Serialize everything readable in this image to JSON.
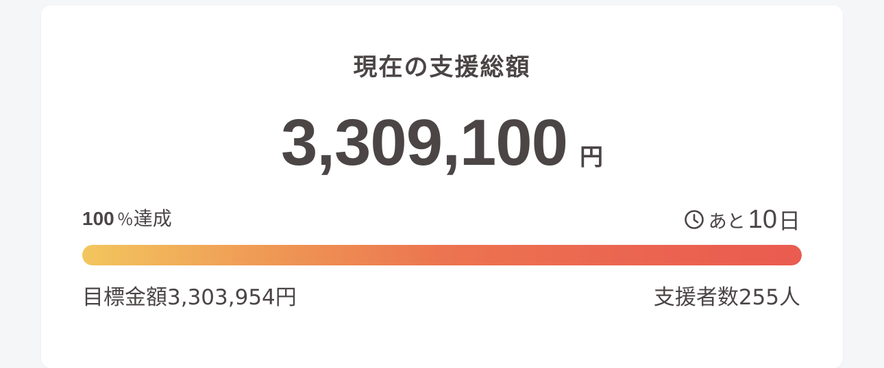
{
  "summary": {
    "title": "現在の支援総額",
    "amount": "3,309,100",
    "amount_unit": "円"
  },
  "progress": {
    "percent_value": "100",
    "percent_sign": "％",
    "achieved_label": "達成",
    "fill_fraction": 1.0,
    "gradient_colors": [
      "#f3c65e",
      "#ef9a55",
      "#ec7450",
      "#eb6650",
      "#ea5b50"
    ]
  },
  "remaining": {
    "icon": "clock-icon",
    "prefix": "あと",
    "days": "10",
    "unit": "日"
  },
  "footer": {
    "goal_text": "目標金額3,303,954円",
    "backers_text": "支援者数255人"
  }
}
